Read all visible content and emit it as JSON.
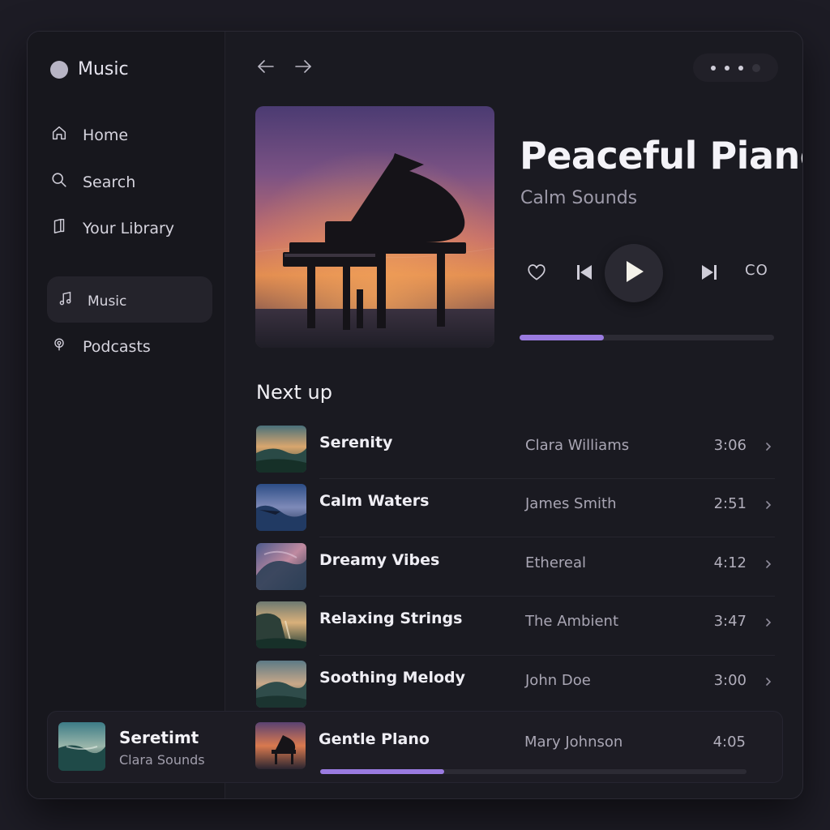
{
  "app": {
    "title": "Music"
  },
  "sidebar": {
    "nav": [
      {
        "label": "Home",
        "icon": "home-icon"
      },
      {
        "label": "Search",
        "icon": "search-icon"
      },
      {
        "label": "Your Library",
        "icon": "library-icon"
      }
    ],
    "sections": [
      {
        "label": "Music",
        "icon": "music-note-icon",
        "active": true
      },
      {
        "label": "Podcasts",
        "icon": "podcast-icon",
        "active": false
      }
    ]
  },
  "toolbar": {
    "back_icon": "arrow-left-icon",
    "forward_icon": "arrow-right-icon",
    "more_icon": "more-dots-icon"
  },
  "now_playing": {
    "title": "Peaceful Piano",
    "subtitle": "Calm Sounds",
    "cover": "grand-piano-sunset",
    "controls": {
      "like": "heart-icon",
      "previous": "skip-previous-icon",
      "play": "play-icon",
      "next": "skip-next-icon",
      "extra_label": "CO"
    },
    "progress": 0.33
  },
  "queue": {
    "title": "Next up",
    "tracks": [
      {
        "title": "Serenity",
        "artist": "Clara Williams",
        "duration": "3:06"
      },
      {
        "title": "Calm Waters",
        "artist": "James Smith",
        "duration": "2:51"
      },
      {
        "title": "Dreamy Vibes",
        "artist": "Ethereal",
        "duration": "4:12"
      },
      {
        "title": "Relaxing Strings",
        "artist": "The Ambient",
        "duration": "3:47"
      },
      {
        "title": "Soothing Melody",
        "artist": "John Doe",
        "duration": "3:00"
      }
    ]
  },
  "player_bar": {
    "title": "Seretimt",
    "subtitle": "Clara Sounds",
    "track": {
      "title": "Gentle Plano",
      "artist": "Mary Johnson",
      "duration": "4:05"
    },
    "progress": 0.29
  },
  "colors": {
    "accent": "#9a7be0",
    "background": "#1a1a21",
    "sidebar": "#17171d"
  }
}
